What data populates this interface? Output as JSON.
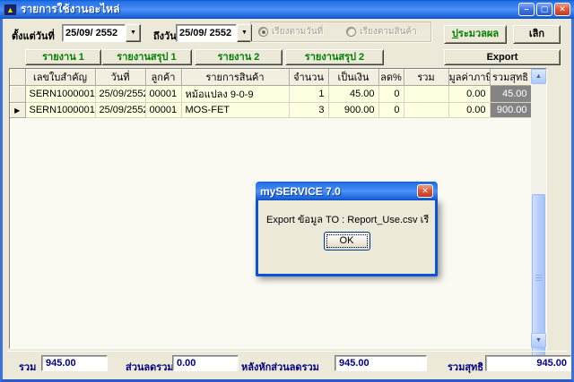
{
  "window": {
    "title": "รายการใช้งานอะไหล่",
    "icon_glyph": "▲",
    "controls": {
      "minimize": "–",
      "maximize": "▢",
      "close": "✕"
    }
  },
  "filters": {
    "from_label": "ตั้งแต่วันที่",
    "from_value": "25/09/ 2552",
    "to_label": "ถึงวันที่",
    "to_value": "25/09/ 2552",
    "dropdown_arrow": "▼",
    "sort_options": [
      {
        "label": "เรียงตามวันที่",
        "selected": true
      },
      {
        "label": "เรียงตามสินค้า",
        "selected": false
      }
    ],
    "process_label": "ประมวลผล",
    "quit_label": "เลิก"
  },
  "tabs": {
    "tab1": "รายงาน 1",
    "tab2": "รายงานสรุป 1",
    "tab3": "รายงาน 2",
    "tab4": "รายงานสรุป 2",
    "export_label": "Export"
  },
  "grid": {
    "headers": [
      "เลขใบสำคัญ",
      "วันที่",
      "ลูกค้า",
      "รายการสินค้า",
      "จำนวน",
      "เป็นเงิน",
      "ลด%",
      "รวม",
      "มูลค่าภาษี",
      "รวมสุทธิ"
    ],
    "selector_arrow": "▶",
    "scroll_up": "▲",
    "scroll_down": "▼",
    "rows": [
      {
        "doc_no": "SERN1000001",
        "date": "25/09/2552",
        "customer": "00001",
        "item": "หม้อแปลง 9-0-9",
        "qty": "1",
        "amount": "45.00",
        "discount_pct": "0",
        "line_total": "",
        "vat": "0.00",
        "net": "45.00"
      },
      {
        "doc_no": "SERN1000001",
        "date": "25/09/2552",
        "customer": "00001",
        "item": "MOS-FET",
        "qty": "3",
        "amount": "900.00",
        "discount_pct": "0",
        "line_total": "",
        "vat": "0.00",
        "net": "900.00"
      }
    ]
  },
  "dialog": {
    "title": "mySERVICE 7.0",
    "close": "✕",
    "message": "Export ข้อมูล TO : Report_Use.csv เรียบร้อยแล้ว...",
    "ok_label": "OK"
  },
  "summary": {
    "total_label": "รวม",
    "total_value": "945.00",
    "discount_label": "ส่วนลดรวม",
    "discount_value": "0.00",
    "after_discount_label": "หลังหักส่วนลดรวม",
    "after_discount_value": "945.00",
    "net_label": "รวมสุทธิ",
    "net_value": "945.00"
  },
  "colors": {
    "titlebar_blue": "#3E85F2",
    "content_bg": "#ECE9D8",
    "row_yellow": "#FFFFE1",
    "net_cell_gray": "#848484",
    "accent_green": "#008000",
    "navy_text": "#000080",
    "close_red": "#E25A3C"
  }
}
